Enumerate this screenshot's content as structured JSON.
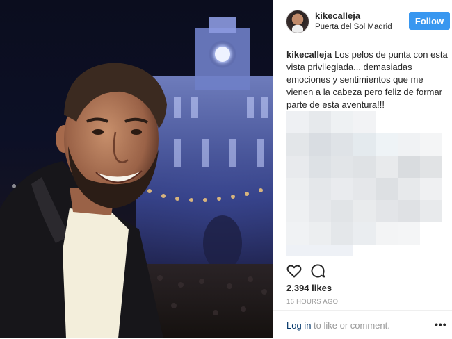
{
  "post": {
    "username": "kikecalleja",
    "location": "Puerta del Sol Madrid",
    "follow_label": "Follow",
    "caption_user": "kikecalleja",
    "caption_text": "Los pelos de punta con esta vista privilegiada... demasiadas emociones y sentimientos que me vienen a la cabeza pero feliz de formar parte de esta aventura!!!",
    "likes": "2,394 likes",
    "time": "16 HOURS AGO",
    "login_link": "Log in",
    "login_rest": " to like or comment.",
    "more_label": "•••"
  },
  "icons": {
    "like": "heart-icon",
    "comment": "comment-icon",
    "more": "more-options-icon"
  },
  "colors": {
    "follow_button": "#3897f0",
    "link": "#003569",
    "muted": "#999999",
    "text": "#262626"
  }
}
